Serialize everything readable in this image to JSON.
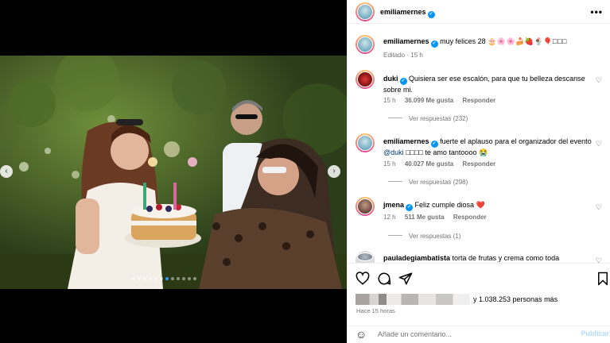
{
  "header": {
    "username": "emiliamernes",
    "more_label": "•••"
  },
  "caption": {
    "username": "emiliamernes",
    "text": "muy felices 28",
    "emojis": "🎂🌸🌸🍰🍓🍨🎈□□□",
    "meta": "Editado · 15 h"
  },
  "comments": [
    {
      "username": "duki",
      "text": "Quisiera ser ese escalón, para que tu belleza descanse sobre mi.",
      "time": "15 h",
      "likes": "36.099 Me gusta",
      "reply": "Responder",
      "view_replies": "Ver respuestas (232)"
    },
    {
      "username": "emiliamernes",
      "text_a": "fuerte el aplauso para el organizador del evento ",
      "mention": "@duki",
      "text_b": " □□□□ te amo tantoooo 😭",
      "time": "15 h",
      "likes": "40.027 Me gusta",
      "reply": "Responder",
      "view_replies": "Ver respuestas (298)"
    },
    {
      "username": "jmena",
      "text": "Feliz cumple diosa ❤️",
      "time": "12 h",
      "likes": "511 Me gusta",
      "reply": "Responder",
      "view_replies": "Ver respuestas (1)"
    },
    {
      "username": "pauladegiambatista",
      "text": "torta de frutas y crema como toda"
    }
  ],
  "likes": {
    "others": "y 1.038.253 personas más"
  },
  "posted": "Hace 15 horas",
  "comment_box": {
    "placeholder": "Añade un comentario...",
    "post_label": "Publicar"
  },
  "carousel": {
    "prev": "‹",
    "next": "›"
  },
  "colors": {
    "verified": "#0095f6",
    "link": "#00376b",
    "active_dot": "#3797f0"
  }
}
